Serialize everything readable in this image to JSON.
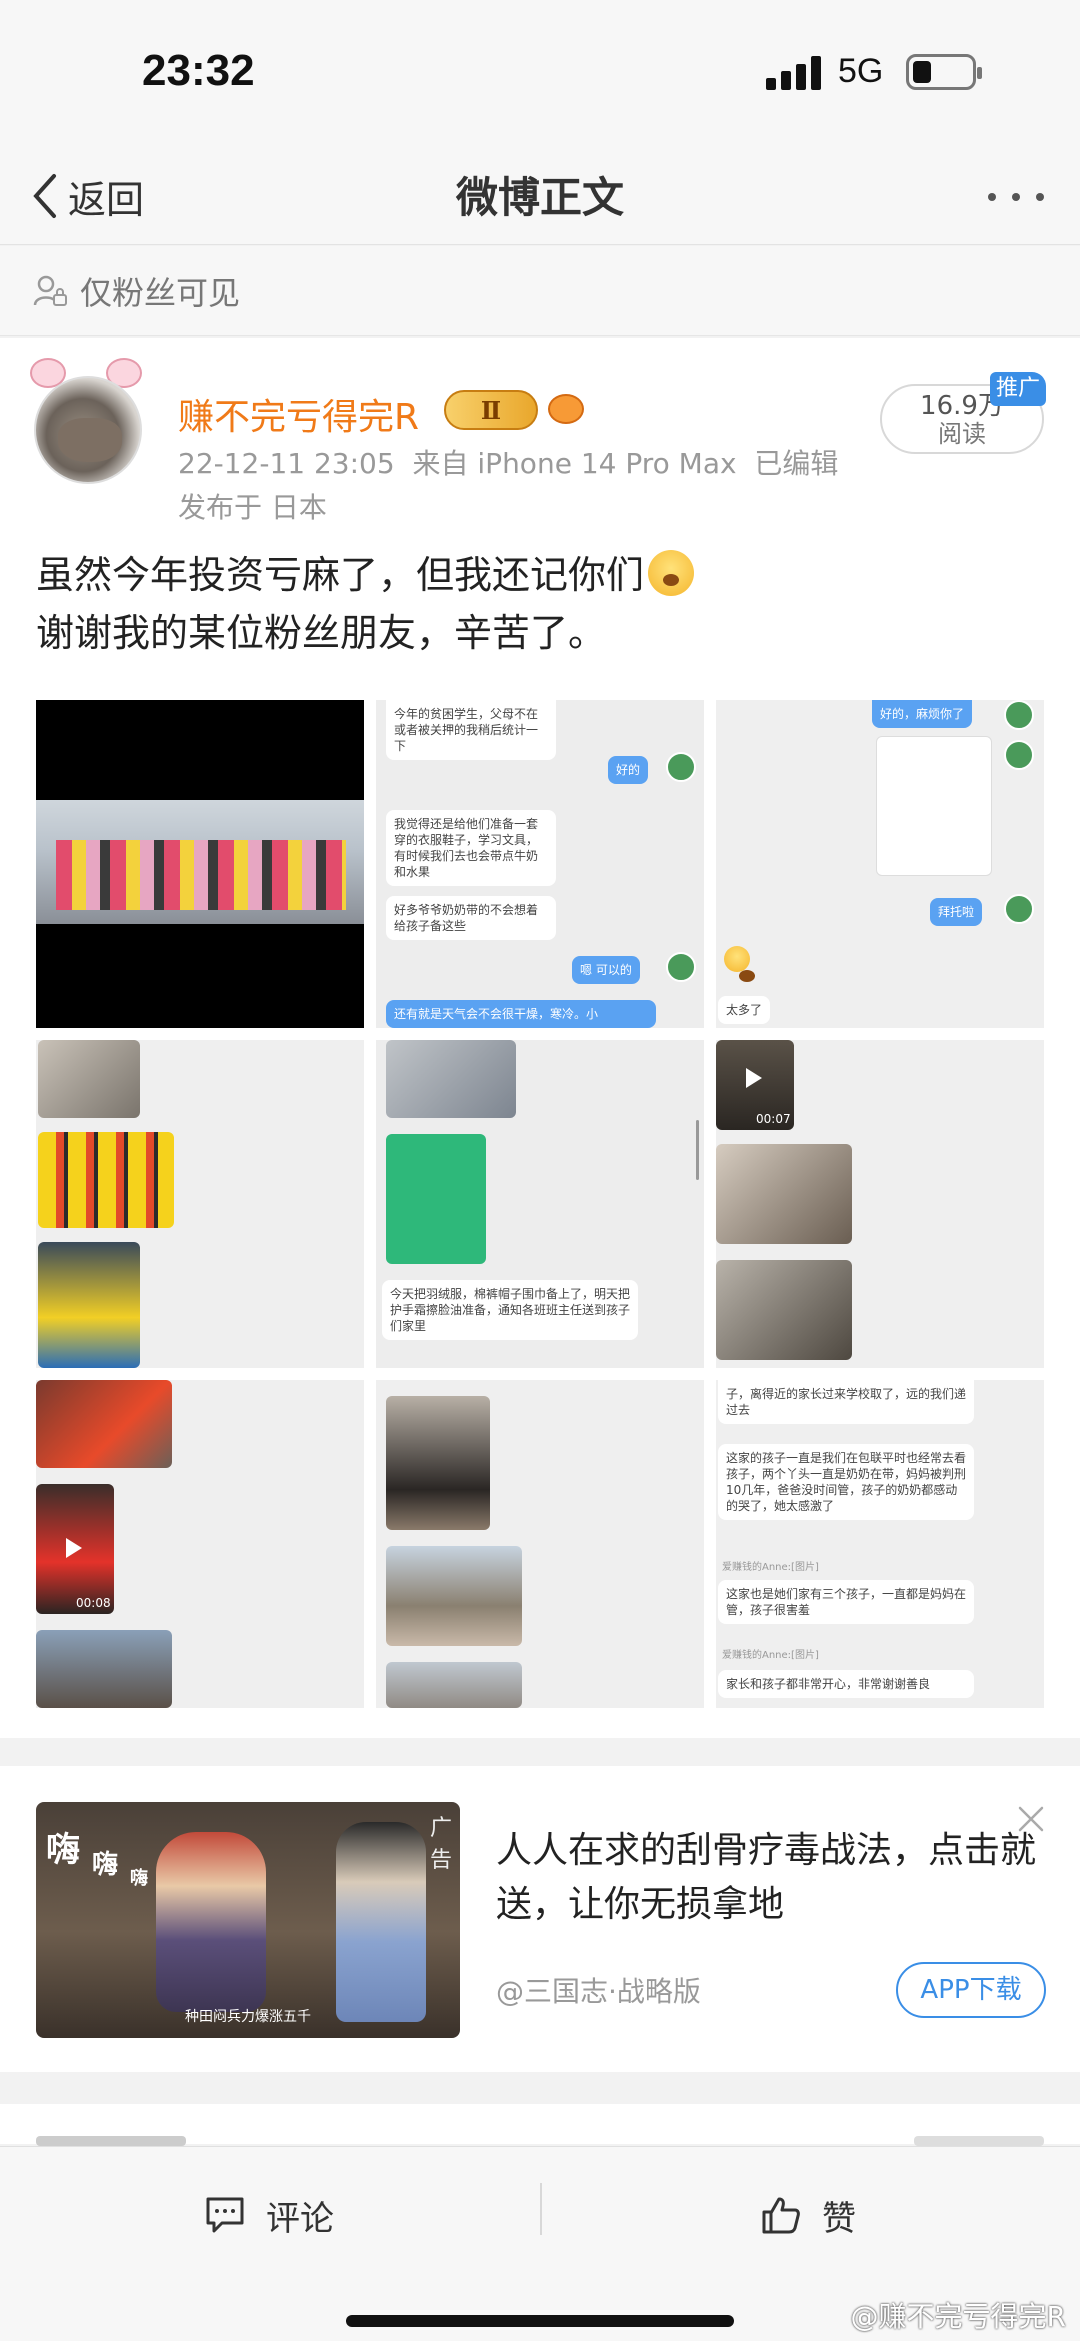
{
  "status_bar": {
    "time": "23:32",
    "network": "5G"
  },
  "nav": {
    "back_label": "返回",
    "title": "微博正文"
  },
  "visibility": {
    "label": "仅粉丝可见"
  },
  "post": {
    "username": "赚不完亏得完R",
    "vip_level": "Ⅱ",
    "timestamp": "22-12-11 23:05",
    "source": "来自 iPhone 14 Pro Max",
    "edited": "已编辑",
    "location": "发布于 日本",
    "reads_count": "16.9万",
    "reads_label": "阅读",
    "promo_tag": "推广",
    "text_line1": "虽然今年投资亏麻了，但我还记你们",
    "text_line2": "谢谢我的某位粉丝朋友，辛苦了。"
  },
  "grid": {
    "cell2": {
      "msg1": "今年的贫困学生，父母不在或者被关押的我稍后统计一下",
      "msg2": "好的",
      "msg3": "我觉得还是给他们准备一套穿的衣服鞋子，学习文具，有时候我们去也会带点牛奶和水果",
      "msg4": "好多爷爷奶奶带的不会想着给孩子备这些",
      "msg5": "嗯 可以的",
      "msg6": "还有就是天气会不会很干燥，寒冷。小"
    },
    "cell3": {
      "msg1": "好的，麻烦你了",
      "msg2": "拜托啦",
      "msg3": "太多了"
    },
    "cell5": {
      "msg1": "今天把羽绒服，棉裤帽子围巾备上了，明天把护手霜擦脸油准备，通知各班班主任送到孩子们家里"
    },
    "cell6": {
      "video_duration": "00:07"
    },
    "cell7": {
      "video_duration": "00:08"
    },
    "cell9": {
      "msg1": "子，离得近的家长过来学校取了，远的我们递过去",
      "msg2": "这家的孩子一直是我们在包联平时也经常去看孩子，两个丫头一直是奶奶在带，妈妈被判刑10几年，爸爸没时间管，孩子的奶奶都感动的哭了，她太感激了",
      "msg3": "爱赚钱的Anne:[图片]",
      "msg4": "这家也是她们家有三个孩子，一直都是妈妈在管，孩子很害羞",
      "msg5": "爱赚钱的Anne:[图片]",
      "msg6": "家长和孩子都非常开心，非常谢谢善良"
    }
  },
  "ad": {
    "label": "广告",
    "title": "人人在求的刮骨疗毒战法，点击就送，让你无损拿地",
    "source": "@三国志·战略版",
    "download_label": "APP下载",
    "image_text_1": "嗨",
    "image_text_2": "嗨",
    "image_text_3": "嗨",
    "image_caption": "种田闷兵力爆涨五千"
  },
  "bottom_bar": {
    "comment_label": "评论",
    "like_label": "赞",
    "watermark": "@赚不完亏得完R"
  },
  "colors": {
    "accent": "#f07a18",
    "link_blue": "#3a8ee6",
    "background": "#f2f2f2"
  }
}
